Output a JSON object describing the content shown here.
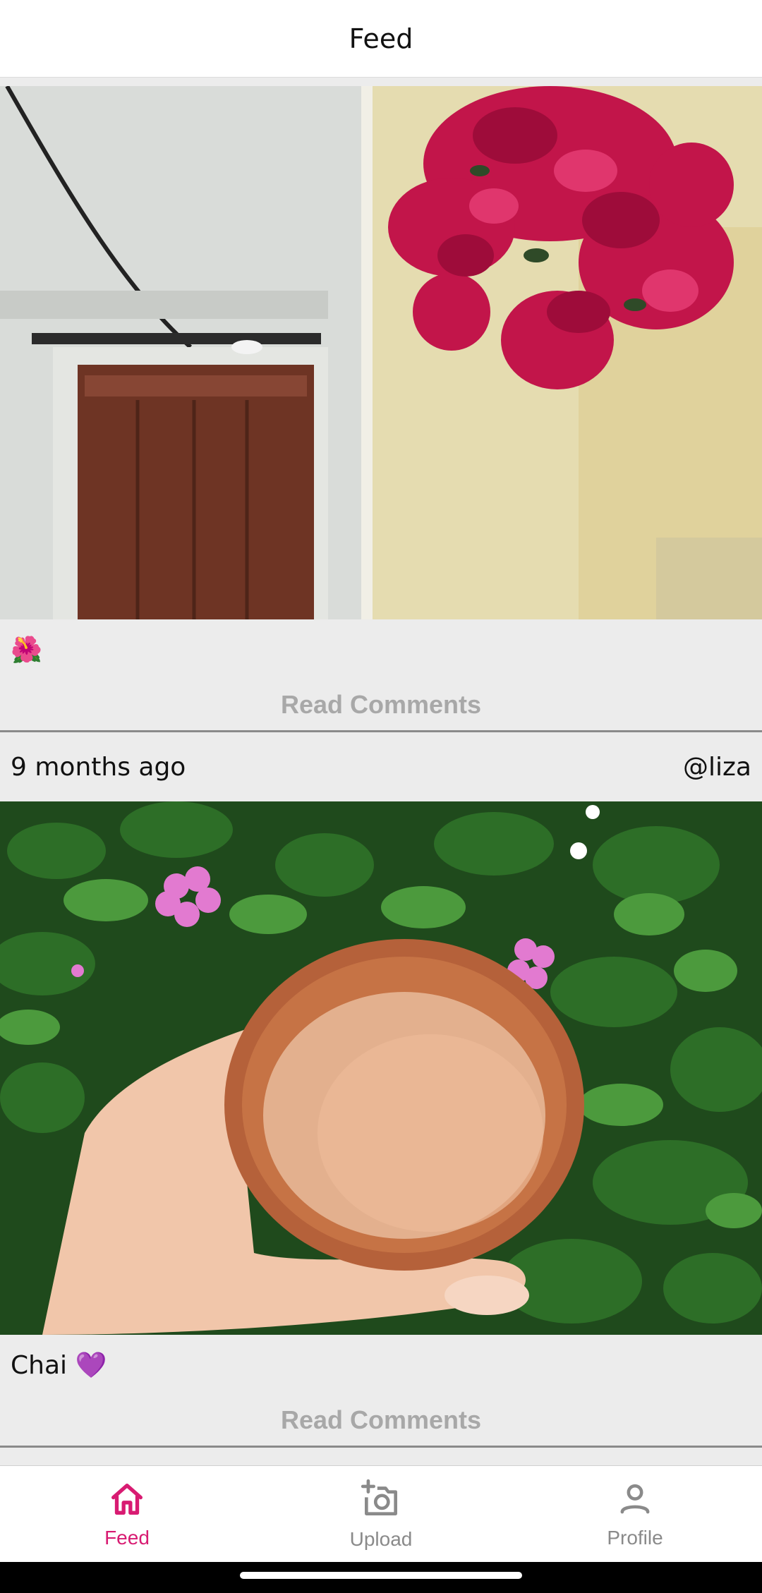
{
  "header": {
    "title": "Feed"
  },
  "posts": [
    {
      "caption": "🌺",
      "read_comments": "Read Comments"
    },
    {
      "time": "9 months ago",
      "user": "@liza",
      "caption": "Chai 💜",
      "read_comments": "Read Comments"
    }
  ],
  "nav": {
    "active_color": "#d81b72",
    "inactive_color": "#8a8a8a",
    "items": [
      {
        "label": "Feed",
        "icon": "home-icon",
        "active": true
      },
      {
        "label": "Upload",
        "icon": "add-photo-icon",
        "active": false
      },
      {
        "label": "Profile",
        "icon": "person-icon",
        "active": false
      }
    ]
  }
}
